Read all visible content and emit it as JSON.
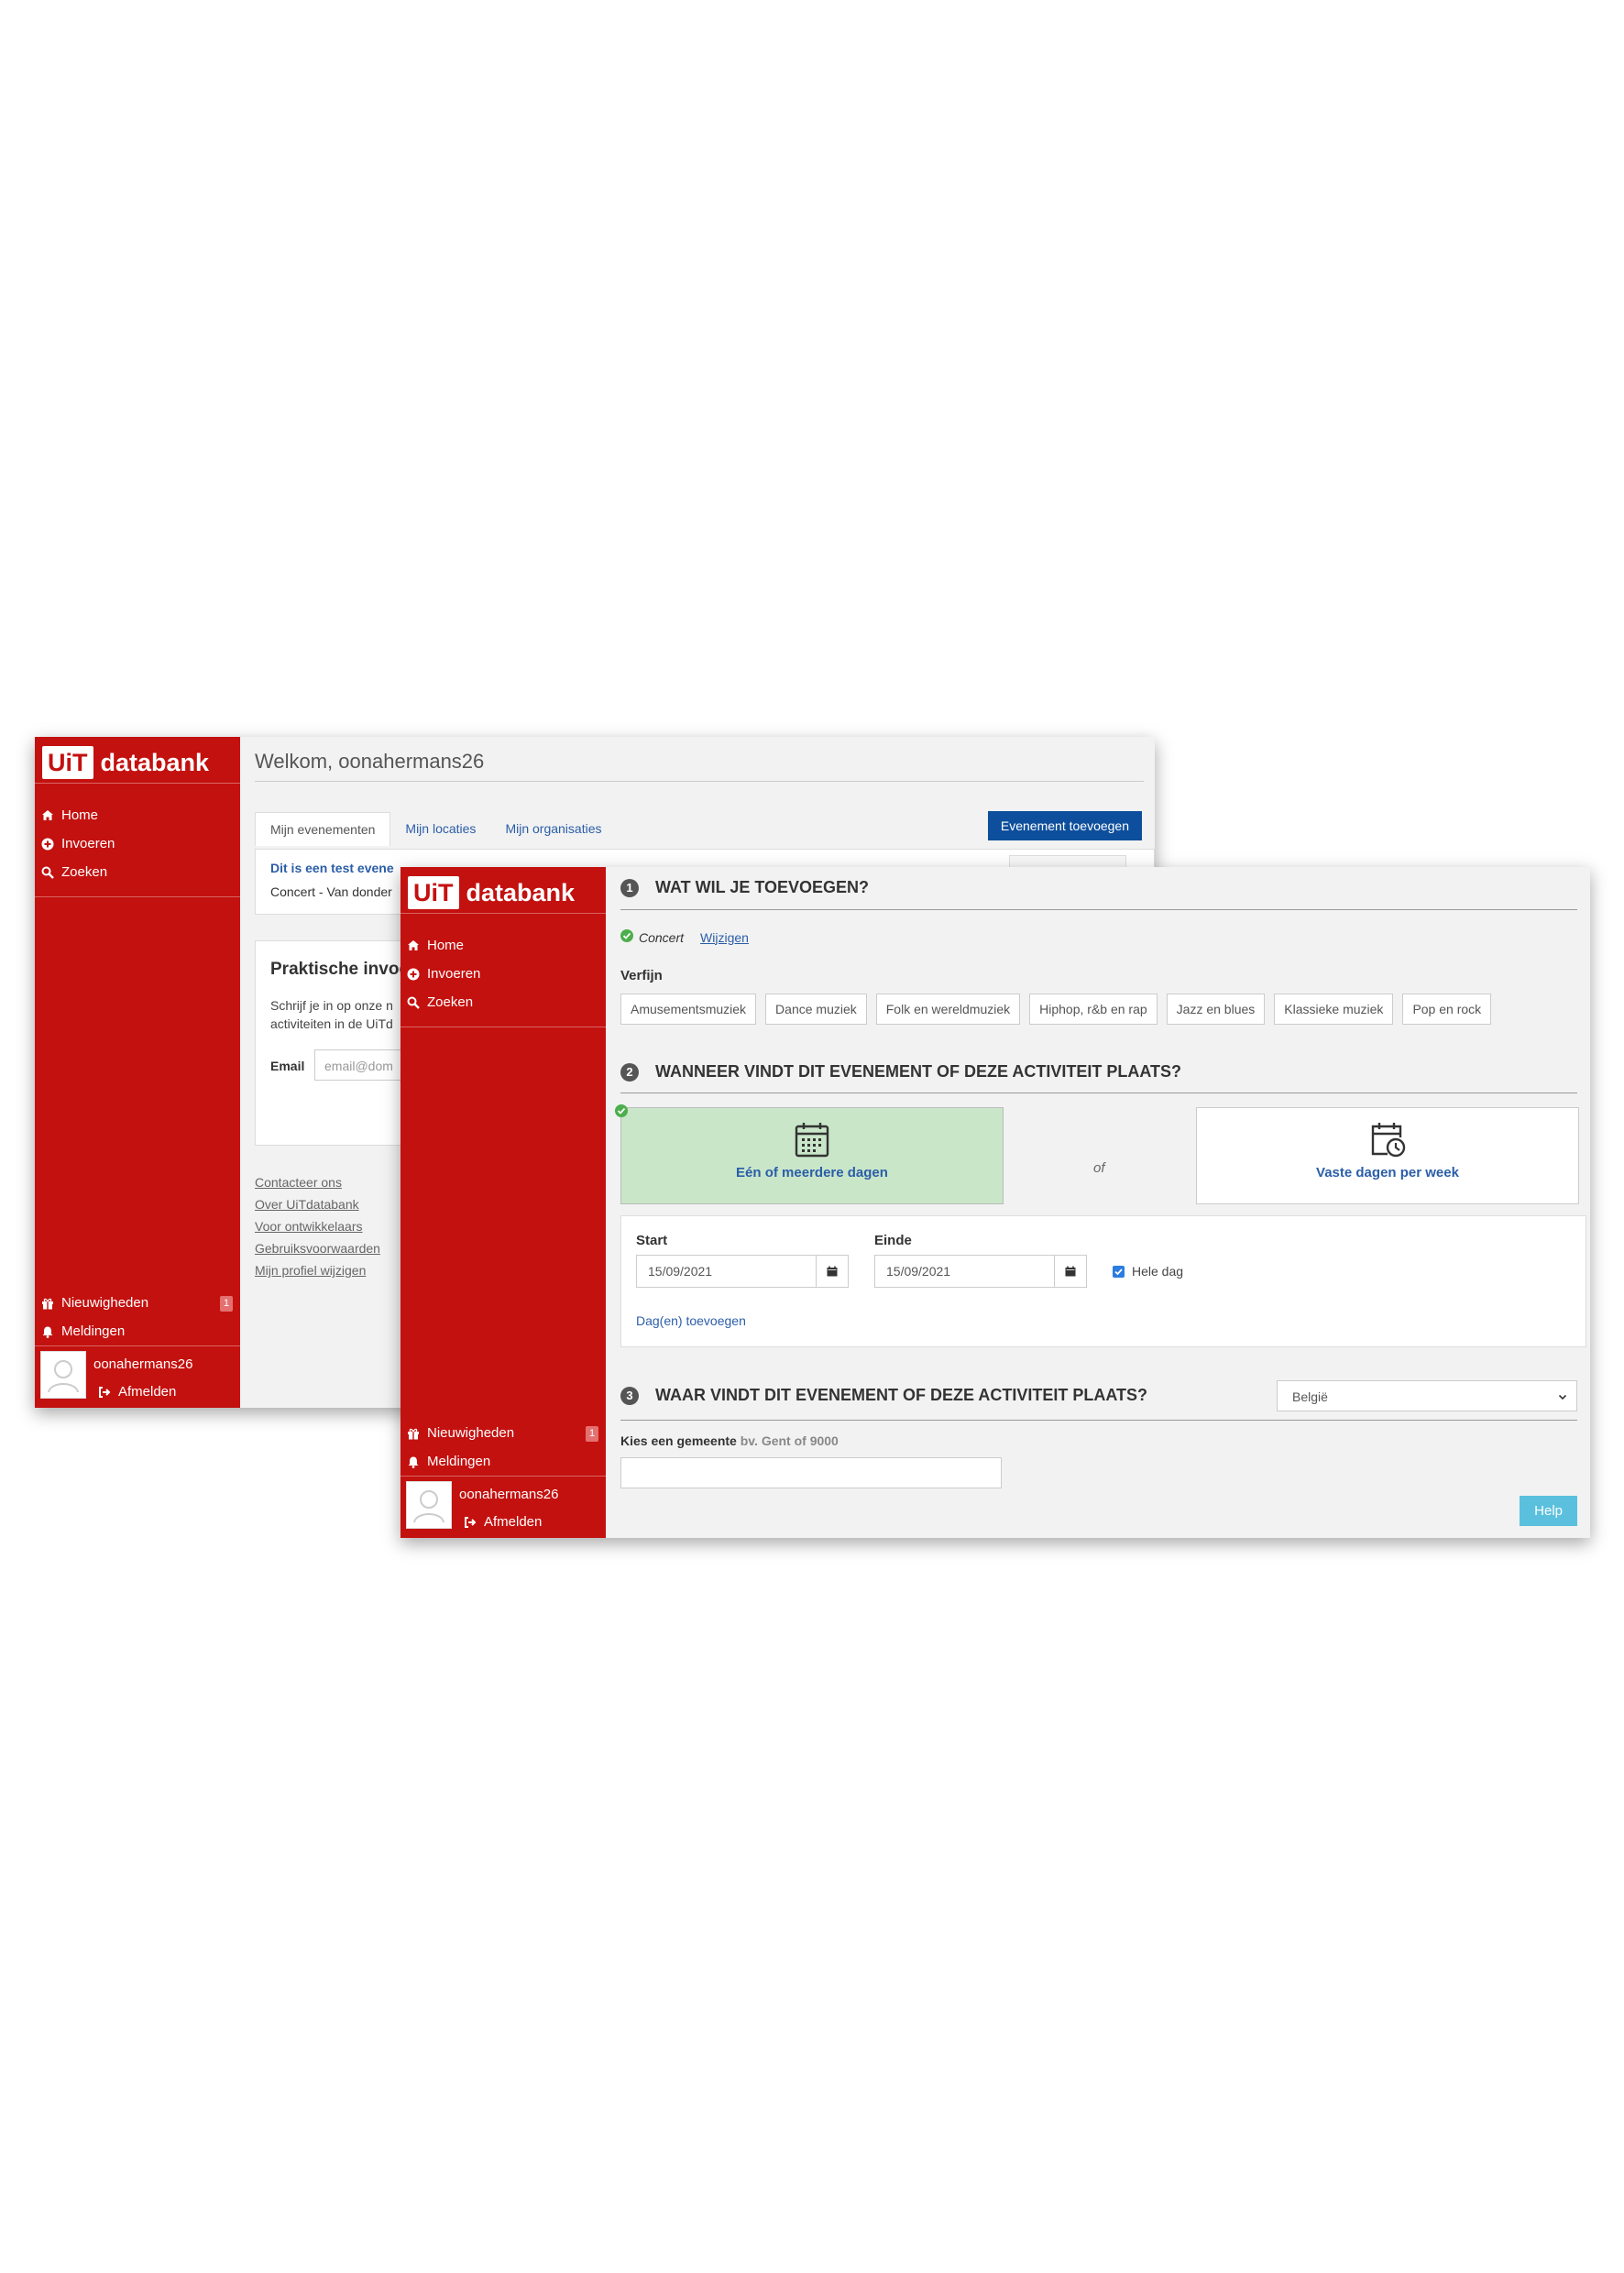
{
  "brand": {
    "badge": "UiT",
    "name": "databank"
  },
  "nav": {
    "home": "Home",
    "invoeren": "Invoeren",
    "zoeken": "Zoeken"
  },
  "bottom_nav": {
    "nieuwigheden": "Nieuwigheden",
    "nieuwigheden_count": "1",
    "meldingen": "Meldingen"
  },
  "user": {
    "name": "oonahermans26",
    "logout": "Afmelden"
  },
  "back": {
    "welcome": "Welkom, oonahermans26",
    "tabs": [
      "Mijn evenementen",
      "Mijn locaties",
      "Mijn organisaties"
    ],
    "add_button": "Evenement toevoegen",
    "event_title": "Dit is een test evene",
    "event_sub": "Concert - Van donder",
    "practical_title": "Praktische invoe",
    "practical_p1": "Schrijf je in op onze n",
    "practical_p2": "activiteiten in de UiTd",
    "email_label": "Email",
    "email_placeholder": "email@dom",
    "footer_links": [
      "Contacteer ons",
      "Over UiTdatabank",
      "Voor ontwikkelaars",
      "Gebruiksvoorwaarden",
      "Mijn profiel wijzigen"
    ]
  },
  "front": {
    "step1": {
      "num": "1",
      "title": "WAT WIL JE TOEVOEGEN?",
      "selected": "Concert",
      "change": "Wijzigen",
      "refine_label": "Verfijn",
      "chips": [
        "Amusementsmuziek",
        "Dance muziek",
        "Folk en wereldmuziek",
        "Hiphop, r&b en rap",
        "Jazz en blues",
        "Klassieke muziek",
        "Pop en rock"
      ]
    },
    "step2": {
      "num": "2",
      "title": "WANNEER VINDT DIT EVENEMENT OF DEZE ACTIVITEIT PLAATS?",
      "option_days": "Eén of meerdere dagen",
      "or": "of",
      "option_week": "Vaste dagen per week",
      "start_label": "Start",
      "start_value": "15/09/2021",
      "end_label": "Einde",
      "end_value": "15/09/2021",
      "all_day": "Hele dag",
      "add_days": "Dag(en) toevoegen"
    },
    "step3": {
      "num": "3",
      "title": "WAAR VINDT DIT EVENEMENT OF DEZE ACTIVITEIT PLAATS?",
      "country": "België",
      "municipality_label": "Kies een gemeente",
      "municipality_hint": "bv. Gent of 9000"
    },
    "help_button": "Help"
  },
  "colors": {
    "brand_red": "#c3110f",
    "primary_blue": "#0d4f9c",
    "link_blue": "#2b5ea8",
    "selected_green": "#c9e6c9",
    "help_cyan": "#5bc0de"
  },
  "icons": {
    "home": "home-icon",
    "add": "plus-circle-icon",
    "search": "search-icon",
    "gift": "gift-icon",
    "bell": "bell-icon",
    "logout": "sign-out-icon",
    "calendar": "calendar-icon",
    "calendar_clock": "calendar-clock-icon"
  }
}
